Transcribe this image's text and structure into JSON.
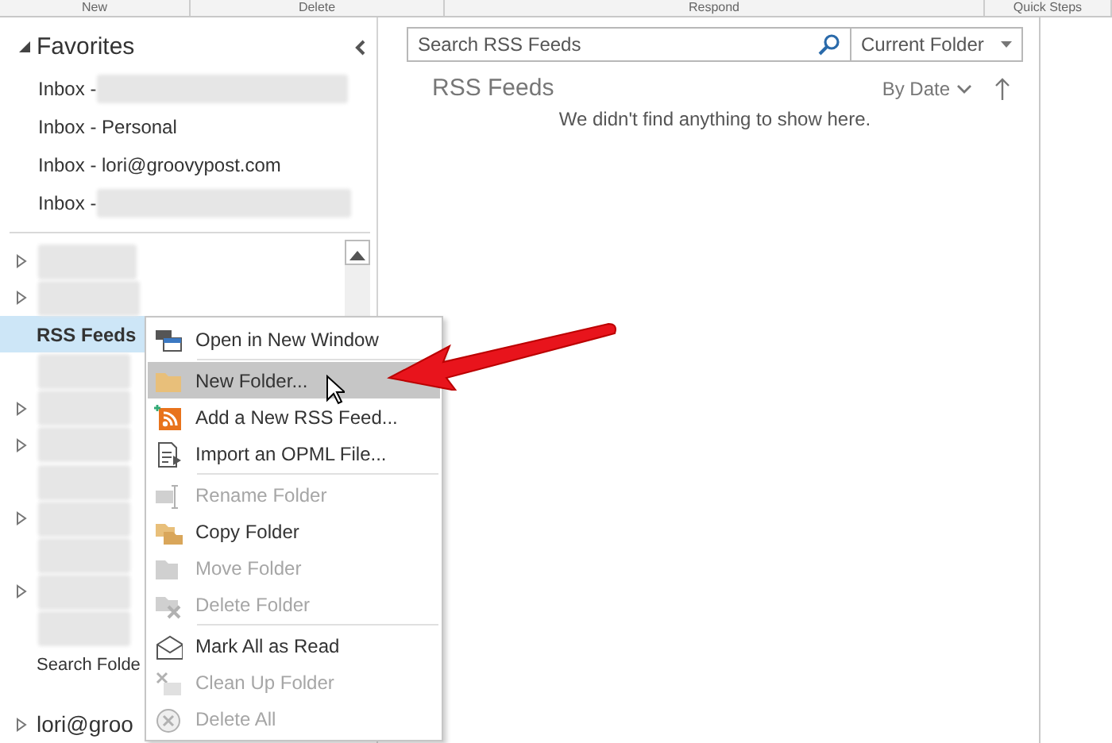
{
  "ribbon": {
    "groups": [
      "New",
      "Delete",
      "Respond",
      "Quick Steps"
    ]
  },
  "favorites": {
    "title": "Favorites",
    "expanded": true,
    "items": [
      {
        "label": "Inbox - ",
        "redacted": true
      },
      {
        "label": "Inbox - Personal",
        "redacted": false
      },
      {
        "label": "Inbox - lori@groovypost.com",
        "redacted": false
      },
      {
        "label": "Inbox - ",
        "redacted": true
      }
    ]
  },
  "folder_tree": [
    {
      "kind": "blurred",
      "expandable": true,
      "selected": false
    },
    {
      "kind": "blurred",
      "expandable": true,
      "selected": false
    },
    {
      "kind": "folder",
      "label": "RSS Feeds",
      "expandable": false,
      "selected": true
    },
    {
      "kind": "blurred",
      "expandable": false,
      "selected": false
    },
    {
      "kind": "blurred",
      "expandable": true,
      "selected": false
    },
    {
      "kind": "blurred",
      "expandable": true,
      "selected": false
    },
    {
      "kind": "blurred",
      "expandable": false,
      "selected": false
    },
    {
      "kind": "blurred",
      "expandable": true,
      "selected": false
    },
    {
      "kind": "blurred",
      "expandable": false,
      "selected": false
    },
    {
      "kind": "blurred",
      "expandable": true,
      "selected": false
    },
    {
      "kind": "blurred",
      "expandable": false,
      "selected": false
    },
    {
      "kind": "folder",
      "label": "Search Folde",
      "expandable": false,
      "selected": false
    },
    {
      "kind": "account",
      "label": "lori@groo",
      "expandable": true,
      "selected": false
    }
  ],
  "search": {
    "placeholder": "Search RSS Feeds",
    "scope": "Current Folder"
  },
  "list": {
    "title": "RSS Feeds",
    "sort": "By Date",
    "empty_message": "We didn't find anything to show here."
  },
  "context_menu": {
    "groups": [
      [
        {
          "label": "Open in New Window",
          "disabled": false,
          "selected": false
        }
      ],
      [
        {
          "label": "New Folder...",
          "disabled": false,
          "selected": true
        },
        {
          "label": "Add a New RSS Feed...",
          "disabled": false,
          "selected": false
        },
        {
          "label": "Import an OPML File...",
          "disabled": false,
          "selected": false
        }
      ],
      [
        {
          "label": "Rename Folder",
          "disabled": true,
          "selected": false
        },
        {
          "label": "Copy Folder",
          "disabled": false,
          "selected": false
        },
        {
          "label": "Move Folder",
          "disabled": true,
          "selected": false
        },
        {
          "label": "Delete Folder",
          "disabled": true,
          "selected": false
        }
      ],
      [
        {
          "label": "Mark All as Read",
          "disabled": false,
          "selected": false
        },
        {
          "label": "Clean Up Folder",
          "disabled": true,
          "selected": false
        },
        {
          "label": "Delete All",
          "disabled": true,
          "selected": false
        }
      ]
    ]
  }
}
